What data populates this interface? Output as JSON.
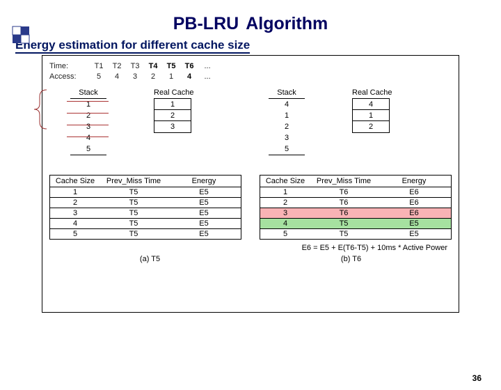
{
  "title_left": "PB-LRU",
  "title_right": "Algorithm",
  "subtitle": "Energy estimation for different cache size",
  "time": {
    "label": "Time:",
    "cols": [
      "T1",
      "T2",
      "T3",
      "T4",
      "T5",
      "T6",
      "..."
    ]
  },
  "access": {
    "label": "Access:",
    "cols": [
      "5",
      "4",
      "3",
      "2",
      "1",
      "4",
      "..."
    ]
  },
  "headers": {
    "stack": "Stack",
    "real": "Real Cache"
  },
  "leftStack": [
    "1",
    "2",
    "3",
    "4",
    "5"
  ],
  "leftReal": [
    "1",
    "2",
    "3"
  ],
  "rightStack": [
    "4",
    "1",
    "2",
    "3",
    "5"
  ],
  "rightReal": [
    "4",
    "1",
    "2"
  ],
  "etab": {
    "h1": "Cache Size",
    "h2": "Prev_Miss Time",
    "h3": "Energy"
  },
  "left_rows": [
    {
      "a": "1",
      "b": "T5",
      "c": "E5"
    },
    {
      "a": "2",
      "b": "T5",
      "c": "E5"
    },
    {
      "a": "3",
      "b": "T5",
      "c": "E5"
    },
    {
      "a": "4",
      "b": "T5",
      "c": "E5"
    },
    {
      "a": "5",
      "b": "T5",
      "c": "E5"
    }
  ],
  "right_rows": [
    {
      "a": "1",
      "b": "T6",
      "c": "E6"
    },
    {
      "a": "2",
      "b": "T6",
      "c": "E6"
    },
    {
      "a": "3",
      "b": "T6",
      "c": "E6",
      "cls": "pink"
    },
    {
      "a": "4",
      "b": "T5",
      "c": "E5",
      "cls": "green"
    },
    {
      "a": "5",
      "b": "T5",
      "c": "E5"
    }
  ],
  "formula": "E6 = E5 + E(T6-T5) + 10ms * Active Power",
  "panel_a": "(a) T5",
  "panel_b": "(b) T6",
  "hl_time_idx": [
    3,
    4,
    5
  ],
  "hl_access_idx": [
    5
  ],
  "pagenum": "36"
}
